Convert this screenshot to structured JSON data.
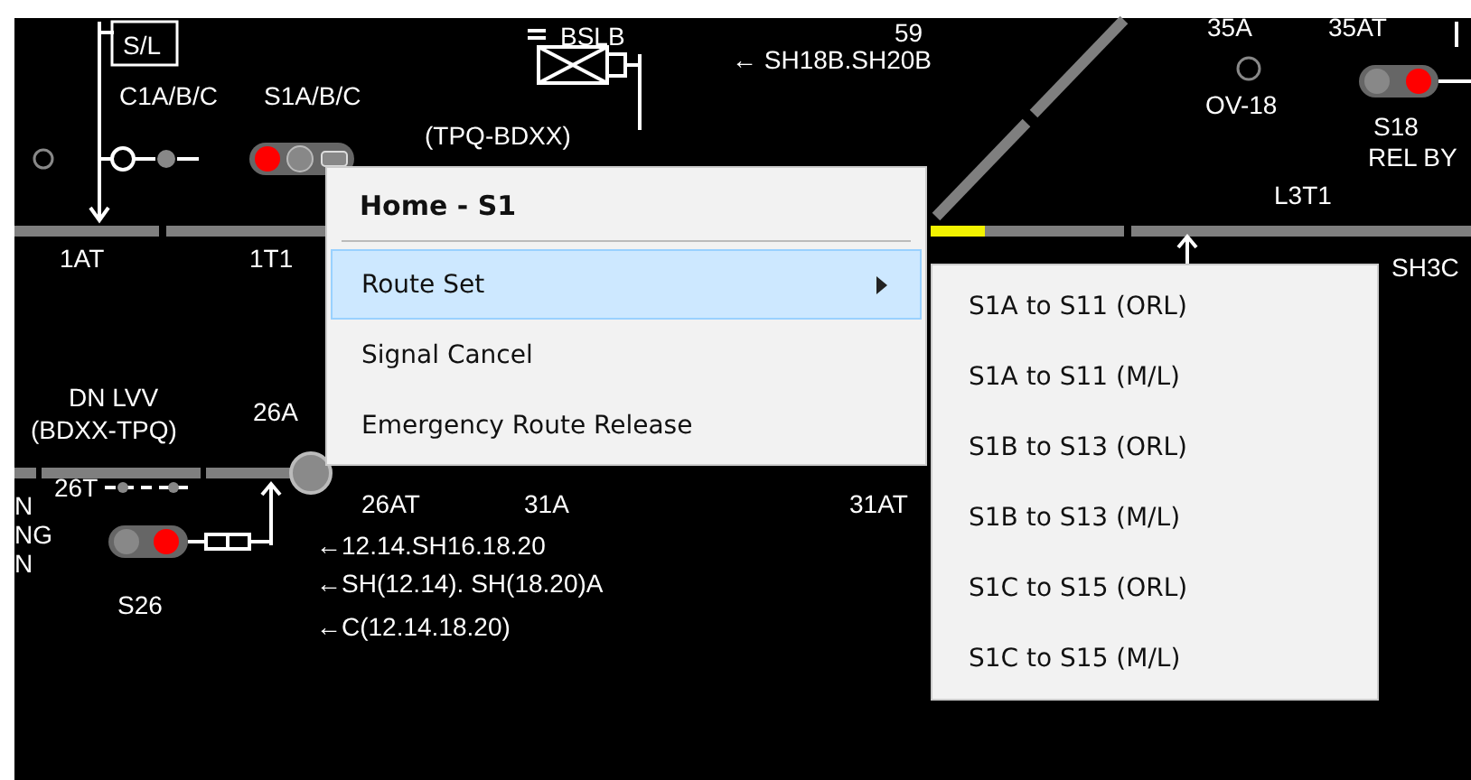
{
  "labels": [
    {
      "text": "S/L",
      "boxed": true
    },
    {
      "text": "C1A/B/C",
      "boxed": false
    },
    {
      "text": "S1A/B/C",
      "boxed": false
    },
    {
      "text": "BSLB",
      "boxed": false
    },
    {
      "text": "59",
      "boxed": false
    },
    {
      "text": "← SH18B.SH20B",
      "boxed": false
    },
    {
      "text": "(TPQ-BDXX)",
      "boxed": false
    },
    {
      "text": "35A",
      "boxed": false
    },
    {
      "text": "35AT",
      "boxed": false
    },
    {
      "text": "OV-18",
      "boxed": false
    },
    {
      "text": "S18",
      "boxed": false
    },
    {
      "text": "REL BY",
      "boxed": false
    },
    {
      "text": "L3T1",
      "boxed": false
    },
    {
      "text": "1AT",
      "boxed": false
    },
    {
      "text": "1T1",
      "boxed": false
    },
    {
      "text": "SH3C",
      "boxed": false
    },
    {
      "text": "DN LVV",
      "boxed": false
    },
    {
      "text": "(BDXX-TPQ)",
      "boxed": false
    },
    {
      "text": "26A",
      "boxed": false
    },
    {
      "text": "26T",
      "boxed": false
    },
    {
      "text": "N",
      "boxed": false
    },
    {
      "text": "NG",
      "boxed": false
    },
    {
      "text": "N",
      "boxed": false
    },
    {
      "text": "S26",
      "boxed": false
    },
    {
      "text": "26AT",
      "boxed": false
    },
    {
      "text": "31A",
      "boxed": false
    },
    {
      "text": "31AT",
      "boxed": false
    },
    {
      "text": "←12.14.SH16.18.20",
      "boxed": false
    },
    {
      "text": "←SH(12.14). SH(18.20)A",
      "boxed": false
    },
    {
      "text": "←C(12.14.18.20)",
      "boxed": false
    }
  ],
  "context_menu": {
    "title": "Home - S1",
    "items": [
      {
        "label": "Route Set",
        "selected": true,
        "has_submenu": true
      },
      {
        "label": "Signal Cancel",
        "selected": false,
        "has_submenu": false
      },
      {
        "label": "Emergency Route Release",
        "selected": false,
        "has_submenu": false
      }
    ]
  },
  "submenu": {
    "items": [
      {
        "label": "S1A to S11 (ORL)"
      },
      {
        "label": "S1A to S11 (M/L)"
      },
      {
        "label": "S1B to S13 (ORL)"
      },
      {
        "label": "S1B to S13 (M/L)"
      },
      {
        "label": "S1C to S15 (ORL)"
      },
      {
        "label": "S1C to S15 (M/L)"
      }
    ]
  }
}
